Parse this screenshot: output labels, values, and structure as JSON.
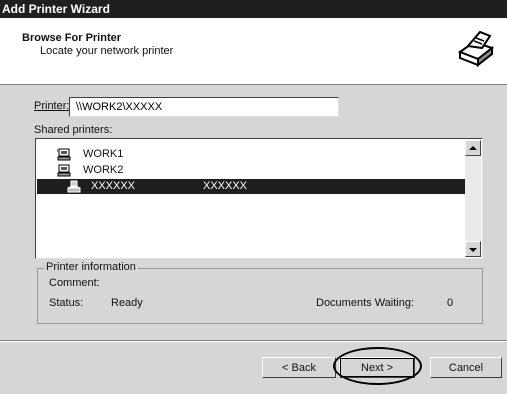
{
  "window": {
    "title": "Add Printer Wizard"
  },
  "header": {
    "title": "Browse For Printer",
    "subtitle": "Locate your network printer",
    "icon": "printer-wizard-icon"
  },
  "printer_field": {
    "label": "Printer:",
    "value": "\\\\WORK2\\XXXXX"
  },
  "shared_printers": {
    "label": "Shared printers:",
    "items": [
      {
        "name": "WORK1",
        "detail": "",
        "icon": "computer-icon",
        "selected": false
      },
      {
        "name": "WORK2",
        "detail": "",
        "icon": "computer-icon",
        "selected": false
      },
      {
        "name": "XXXXXX",
        "detail": "XXXXXX",
        "icon": "printer-icon",
        "selected": true
      }
    ]
  },
  "printer_info": {
    "legend": "Printer information",
    "comment_label": "Comment:",
    "comment_value": "",
    "status_label": "Status:",
    "status_value": "Ready",
    "docs_label": "Documents Waiting:",
    "docs_value": "0"
  },
  "buttons": {
    "back": "< Back",
    "next": "Next >",
    "cancel": "Cancel"
  }
}
